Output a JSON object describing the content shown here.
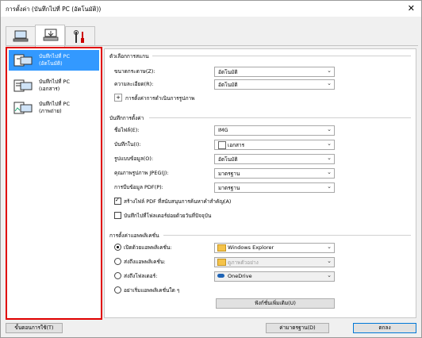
{
  "window": {
    "title": "การตั้งค่า (บันทึกไปที่ PC (อัตโนมัติ))",
    "close_glyph": "✕"
  },
  "tabs": [
    {
      "icon": "computer-icon"
    },
    {
      "icon": "scanner-to-computer-icon"
    },
    {
      "icon": "tools-icon"
    }
  ],
  "sidebar": {
    "items": [
      {
        "label1": "บันทึกไปที่ PC",
        "label2": "(อัตโนมัติ)",
        "selected": true
      },
      {
        "label1": "บันทึกไปที่ PC",
        "label2": "(เอกสาร)",
        "selected": false
      },
      {
        "label1": "บันทึกไปที่ PC",
        "label2": "(ภาพถ่าย)",
        "selected": false
      }
    ]
  },
  "scan_options": {
    "heading": "ตัวเลือกการสแกน",
    "size_label": "ขนาดกระดาษ(Z):",
    "size_value": "อัตโนมัติ",
    "resolution_label": "ความละเอียด(R):",
    "resolution_value": "อัตโนมัติ",
    "image_settings_label": "การตั้งค่าการดำเนินการรูปภาพ"
  },
  "save_settings": {
    "heading": "บันทึกการตั้งค่า",
    "filename_label": "ชื่อไฟล์(E):",
    "filename_value": "IMG",
    "savein_label": "บันทึกใน(I):",
    "savein_value": "เอกสาร",
    "format_label": "รูปแบบข้อมูล(O):",
    "format_value": "อัตโนมัติ",
    "jpeg_label": "คุณภาพรูปภาพ JPEG(J):",
    "jpeg_value": "มาตรฐาน",
    "pdf_label": "การบีบข้อมูล PDF(P):",
    "pdf_value": "มาตรฐาน",
    "searchable_pdf_label": "สร้างไฟล์ PDF ที่สนับสนุนการค้นหาคำสำคัญ(A)",
    "searchable_pdf_checked": true,
    "subfolder_label": "บันทึกไปที่โฟลเดอร์ย่อยด้วยวันที่ปัจจุบัน",
    "subfolder_checked": false
  },
  "app_settings": {
    "heading": "การตั้งค่าแอพพลิเคชั่น",
    "open_app_label": "เปิดด้วยแอพพลิเคชั่น:",
    "open_app_value": "Windows Explorer",
    "send_app_label": "ส่งถึงแอพพลิเคชั่น:",
    "send_app_value": "ดูภาพตัวอย่าง",
    "send_folder_label": "ส่งถึงโฟลเดอร์:",
    "send_folder_value": "OneDrive",
    "no_app_label": "อย่าเริ่มแอพพลิเคชั่นใด ๆ",
    "more_functions_label": "ฟังก์ชั่นเพิ่มเติม(U)",
    "selected_option": "open_app"
  },
  "footer": {
    "instructions_label": "ขั้นตอนการใช้(T)",
    "defaults_label": "ค่ามาตรฐาน(D)",
    "ok_label": "ตกลง"
  },
  "colors": {
    "selection": "#3399ff",
    "highlight_border": "#e00000"
  }
}
